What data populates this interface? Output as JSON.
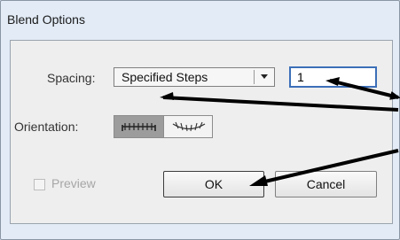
{
  "dialog": {
    "title": "Blend Options"
  },
  "spacing": {
    "label": "Spacing:",
    "selected": "Specified Steps",
    "steps_value": "1"
  },
  "orientation": {
    "label": "Orientation:",
    "options": [
      "align-to-page",
      "align-to-path"
    ],
    "selected": "align-to-page"
  },
  "preview": {
    "label": "Preview",
    "checked": false,
    "enabled": false
  },
  "buttons": {
    "ok": "OK",
    "cancel": "Cancel"
  },
  "annotation": {
    "arrow_color": "#000000"
  }
}
